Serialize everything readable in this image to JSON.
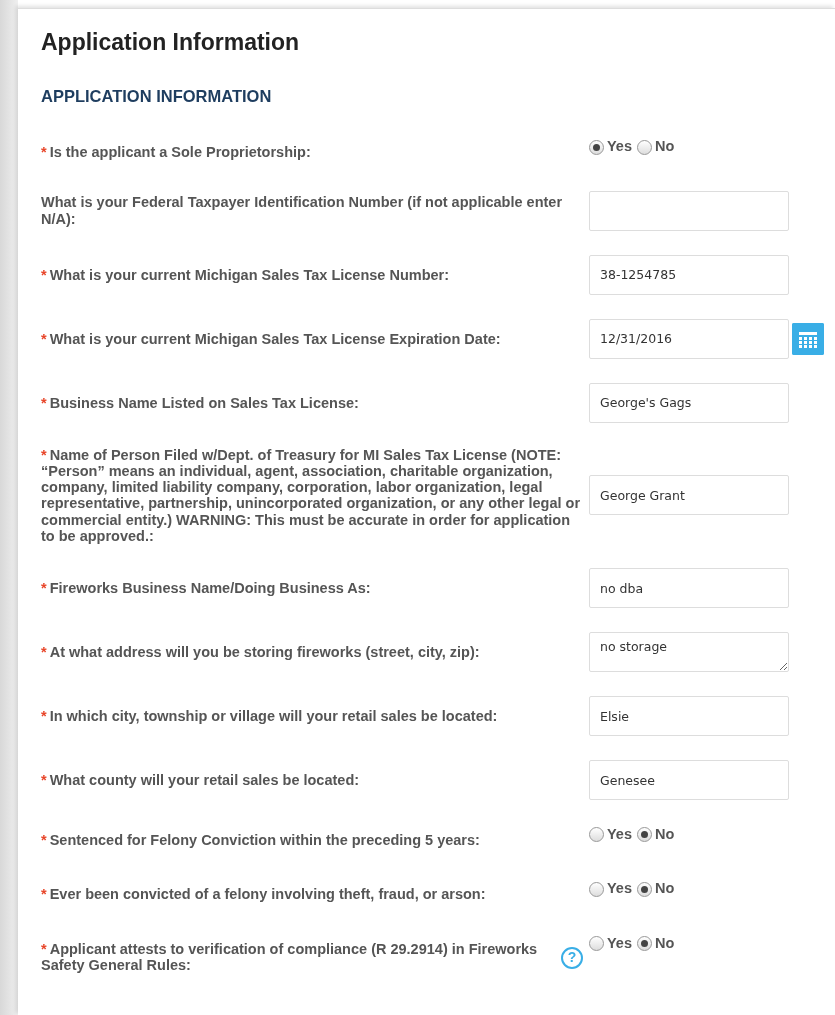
{
  "page_title": "Application Information",
  "section_title": "APPLICATION INFORMATION",
  "required_mark": "*",
  "fields": [
    {
      "kind": "radio",
      "required": true,
      "label": "Is the applicant a Sole Proprietorship:",
      "options": [
        {
          "label": "Yes",
          "selected": true
        },
        {
          "label": "No",
          "selected": false
        }
      ]
    },
    {
      "kind": "text",
      "required": false,
      "label": "What is your Federal Taxpayer Identification Number (if not applicable enter N/A):"
    },
    {
      "kind": "text",
      "required": true,
      "label": "What is your current Michigan Sales Tax License Number:",
      "value": "38-1254785"
    },
    {
      "kind": "date",
      "required": true,
      "label": "What is your current Michigan Sales Tax License Expiration Date:",
      "value": "12/31/2016"
    },
    {
      "kind": "text",
      "required": true,
      "label": "Business Name Listed on Sales Tax License:",
      "value": "George's Gags"
    },
    {
      "kind": "text",
      "required": true,
      "label": "Name of Person Filed w/Dept. of Treasury for MI Sales Tax License (NOTE: “Person” means an individual, agent, association, charitable organization, company, limited liability company, corporation, labor organization, legal representative, partnership, unincorporated organization, or any other legal or commercial entity.) WARNING: This must be accurate in order for application to be approved.:",
      "value": "George Grant"
    },
    {
      "kind": "text",
      "required": true,
      "label": "Fireworks Business Name/Doing Business As:",
      "value": "no dba"
    },
    {
      "kind": "textarea",
      "required": true,
      "label": "At what address will you be storing fireworks (street, city, zip):",
      "value": "no storage"
    },
    {
      "kind": "text",
      "required": true,
      "label": "In which city, township or village will your retail sales be located:",
      "value": "Elsie"
    },
    {
      "kind": "text",
      "required": true,
      "label": "What county will your retail sales be located:",
      "value": "Genesee"
    },
    {
      "kind": "radio",
      "required": true,
      "label": "Sentenced for Felony Conviction within the preceding 5 years:",
      "options": [
        {
          "label": "Yes",
          "selected": false
        },
        {
          "label": "No",
          "selected": true
        }
      ]
    },
    {
      "kind": "radio",
      "required": true,
      "label": "Ever been convicted of a felony involving theft, fraud, or arson:",
      "options": [
        {
          "label": "Yes",
          "selected": false
        },
        {
          "label": "No",
          "selected": true
        }
      ]
    },
    {
      "kind": "radio",
      "required": true,
      "label": "Applicant attests to verification of compliance (R 29.2914) in Fireworks Safety General Rules:",
      "help": "?",
      "options": [
        {
          "label": "Yes",
          "selected": false
        },
        {
          "label": "No",
          "selected": true
        }
      ]
    }
  ]
}
